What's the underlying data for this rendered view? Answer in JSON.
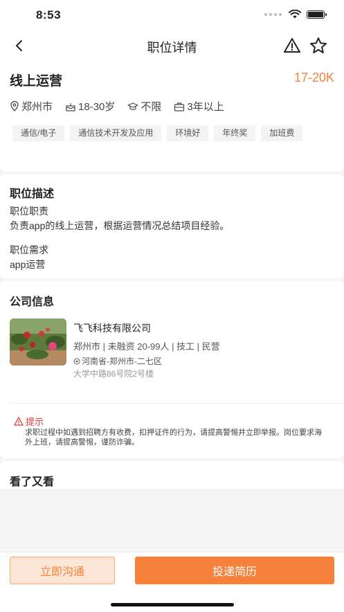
{
  "status_bar": {
    "time": "8:53"
  },
  "nav": {
    "title": "职位详情"
  },
  "job": {
    "title": "线上运营",
    "salary": "17-20K",
    "location": "郑州市",
    "age": "18-30岁",
    "education": "不限",
    "experience": "3年以上",
    "tags": [
      "通信/电子",
      "通信技术开发及应用",
      "环境好",
      "年终奖",
      "加班费"
    ]
  },
  "description": {
    "section_title": "职位描述",
    "duty_label": "职位职责",
    "duty_text": "负责app的线上运营，根据运营情况总结项目经验。",
    "req_label": "职位需求",
    "req_text": "app运营"
  },
  "company": {
    "section_title": "公司信息",
    "name": "飞飞科技有限公司",
    "meta": "郑州市 | 未融资 20-99人 | 技工 | 民营",
    "address": "河南省-郑州市-二七区",
    "address_detail": "大学中路86号院2号楼",
    "tip_title": "提示",
    "tip_text": "求职过程中如遇到招聘方有收费，扣押证件的行为，请提高警惕并立即举报。岗位要求海外上班，请提高警惕，谨防诈骗。"
  },
  "more": {
    "section_title": "看了又看"
  },
  "actions": {
    "chat_label": "立即沟通",
    "apply_label": "投递简历"
  },
  "colors": {
    "accent": "#f5813b",
    "warning": "#e53935"
  }
}
